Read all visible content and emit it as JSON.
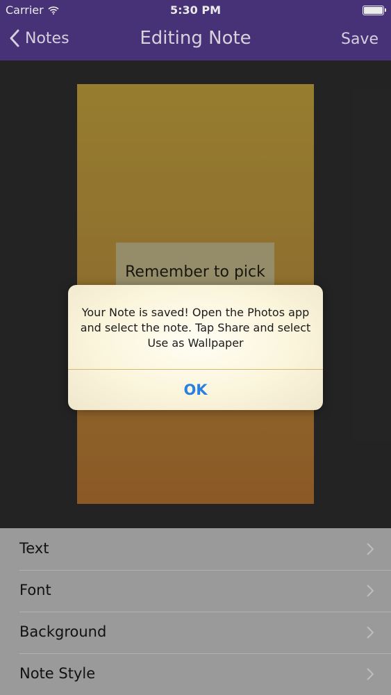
{
  "status_bar": {
    "carrier": "Carrier",
    "time": "5:30 PM"
  },
  "nav": {
    "back_label": "Notes",
    "title": "Editing Note",
    "save_label": "Save"
  },
  "note_preview": {
    "text": "Remember to pick"
  },
  "alert": {
    "message": "Your Note is saved! Open the Photos app and select the note. Tap Share and select Use as Wallpaper",
    "button_label": "OK"
  },
  "settings": {
    "items": [
      {
        "label": "Text"
      },
      {
        "label": "Font"
      },
      {
        "label": "Background"
      },
      {
        "label": "Note Style"
      }
    ]
  },
  "colors": {
    "nav_bar": "#4e3682",
    "alert_button": "#2a7fe0",
    "note_top": "#a38834",
    "note_bottom": "#97602a"
  },
  "icons": {
    "signal": "wifi-icon",
    "back": "chevron-left-icon",
    "row": "chevron-right-icon",
    "battery": "battery-icon"
  }
}
